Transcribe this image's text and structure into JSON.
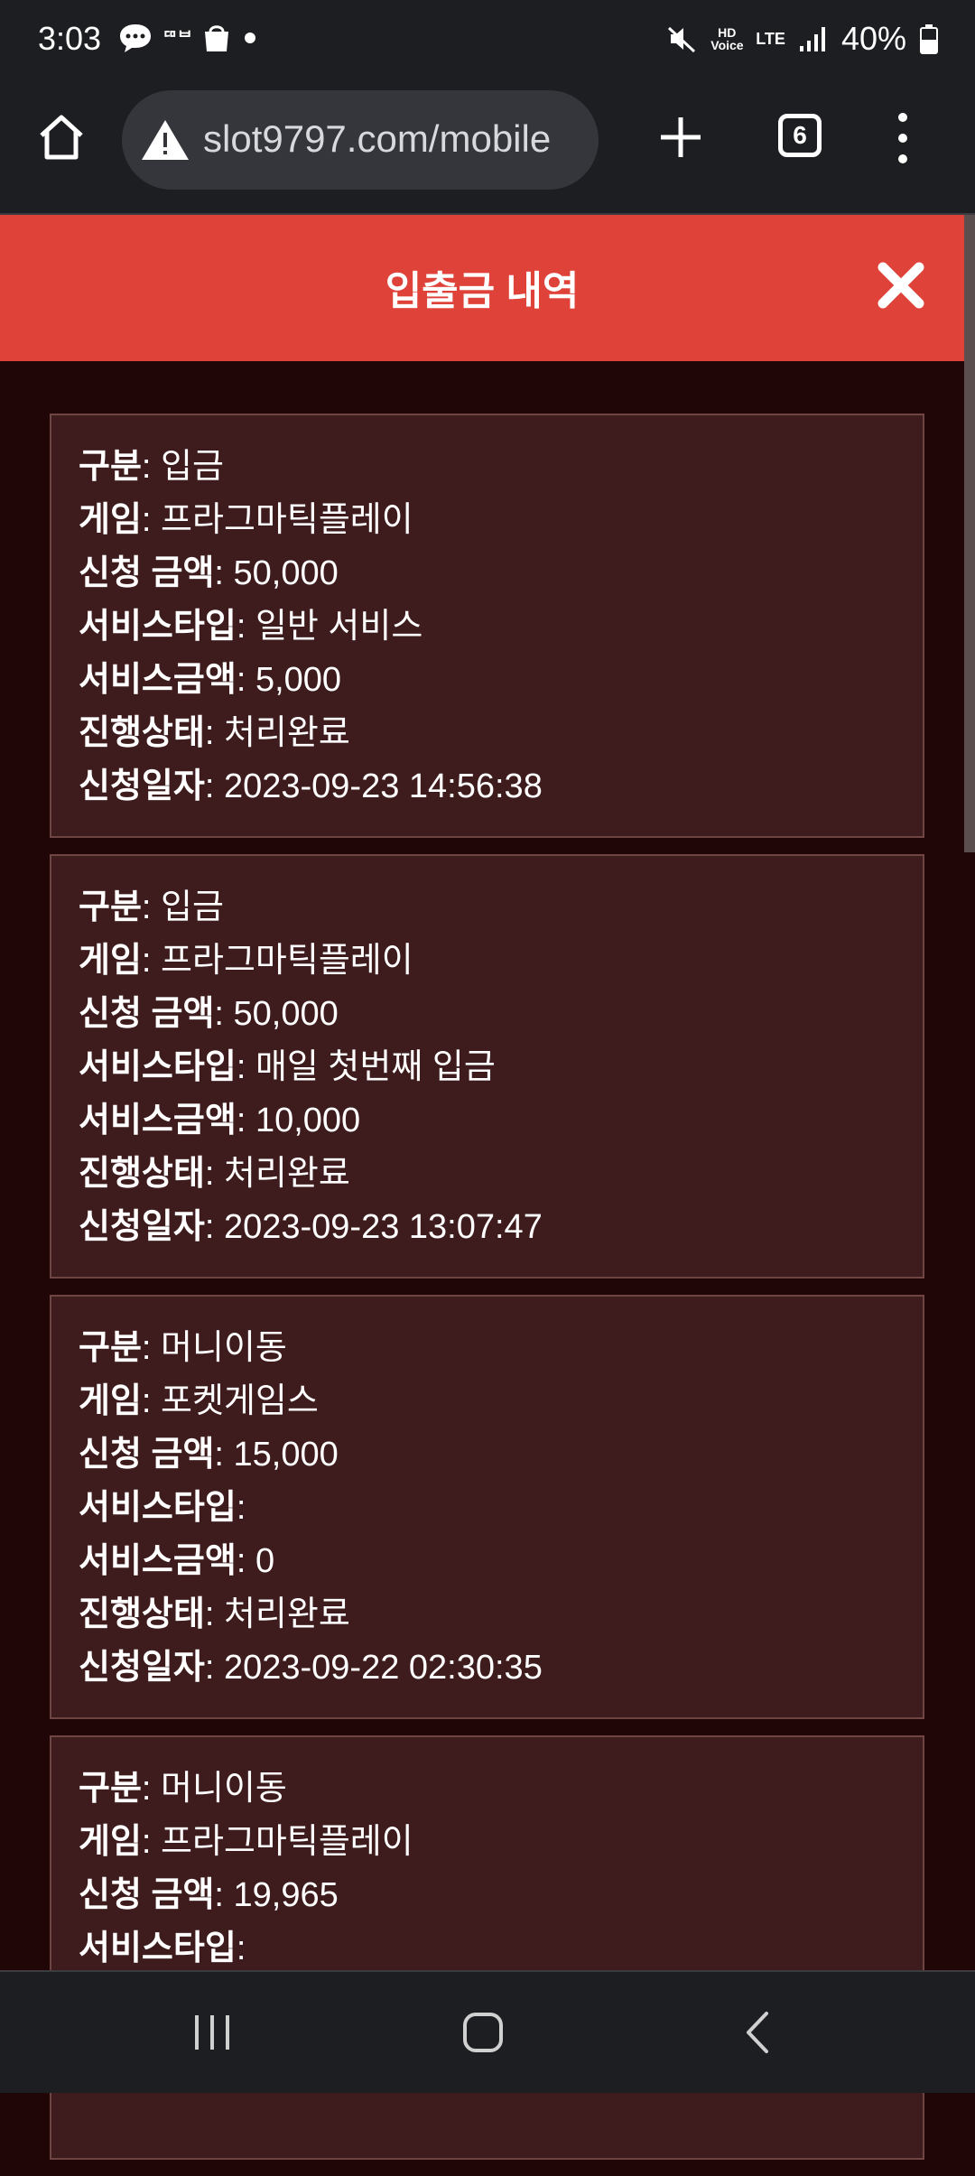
{
  "status_bar": {
    "time": "3:03",
    "left_icons": [
      "chat-bubble-icon",
      "dmb-icon",
      "shopping-bag-icon",
      "dot-icon"
    ],
    "dmb_text": "ᄃᄆᄇ",
    "volte_text": "HD Voice",
    "lte_text": "LTE",
    "battery": "40%"
  },
  "browser": {
    "url": "slot9797.com/mobile",
    "tab_count": "6"
  },
  "modal": {
    "title": "입출금 내역"
  },
  "labels": {
    "type": "구분",
    "game": "게임",
    "amount": "신청 금액",
    "service_type": "서비스타입",
    "service_amount": "서비스금액",
    "status": "진행상태",
    "date": "신청일자"
  },
  "records": [
    {
      "type": "입금",
      "game": "프라그마틱플레이",
      "amount": "50,000",
      "service_type": "일반 서비스",
      "service_amount": "5,000",
      "status": "처리완료",
      "date": "2023-09-23 14:56:38"
    },
    {
      "type": "입금",
      "game": "프라그마틱플레이",
      "amount": "50,000",
      "service_type": "매일 첫번째 입금",
      "service_amount": "10,000",
      "status": "처리완료",
      "date": "2023-09-23 13:07:47"
    },
    {
      "type": "머니이동",
      "game": "포켓게임스",
      "amount": "15,000",
      "service_type": "",
      "service_amount": "0",
      "status": "처리완료",
      "date": "2023-09-22 02:30:35"
    },
    {
      "type": "머니이동",
      "game": "프라그마틱플레이",
      "amount": "19,965",
      "service_type": "",
      "service_amount": "",
      "status": "",
      "date": ""
    }
  ],
  "colors": {
    "header": "#df4239",
    "background": "#200606",
    "card": "#3e1c1d",
    "card_border": "#6e4543"
  }
}
